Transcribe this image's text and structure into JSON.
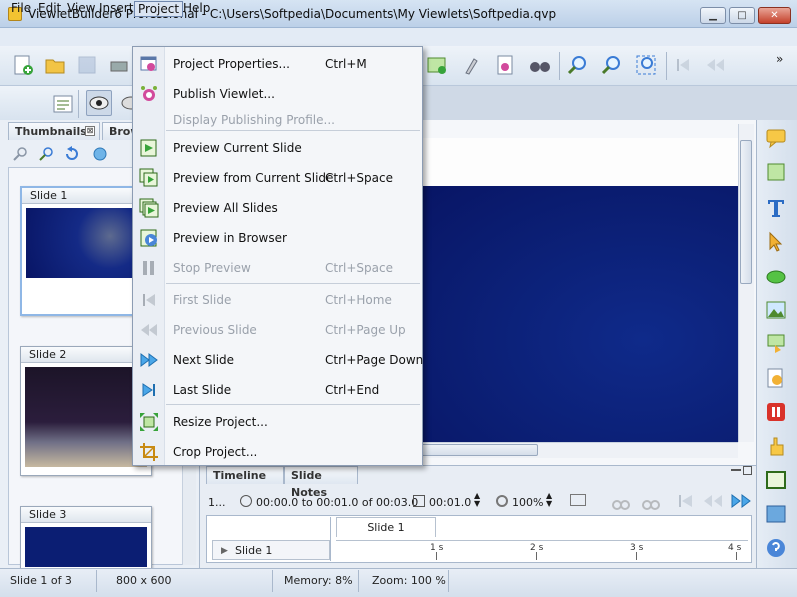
{
  "window": {
    "title": "ViewletBuilder6 Professional - C:\\Users\\Softpedia\\Documents\\My Viewlets\\Softpedia.qvp",
    "minimize": "▁",
    "maximize": "□",
    "close": "✕"
  },
  "menubar": {
    "file": "File",
    "edit": "Edit",
    "view": "View",
    "insert": "Insert",
    "project": "Project",
    "help": "Help"
  },
  "toolbar_overflow": "»",
  "left_panel": {
    "tab_thumbnails": "Thumbnails",
    "tab_close": "⊠",
    "tab_browser": "Brow",
    "slides": [
      {
        "label": "Slide 1"
      },
      {
        "label": "Slide 2"
      },
      {
        "label": "Slide 3"
      }
    ]
  },
  "project_menu": {
    "items": [
      {
        "label": "Project Properties...",
        "shortcut": "Ctrl+M",
        "enabled": true,
        "icon": "properties-icon"
      },
      {
        "label": "Publish Viewlet...",
        "shortcut": "",
        "enabled": true,
        "icon": "publish-icon"
      },
      {
        "label": "Display Publishing Profile...",
        "shortcut": "",
        "enabled": false,
        "icon": ""
      },
      {
        "label": "Preview Current Slide",
        "shortcut": "",
        "enabled": true,
        "icon": "preview-slide-icon"
      },
      {
        "label": "Preview from Current Slide",
        "shortcut": "Ctrl+Space",
        "enabled": true,
        "icon": "preview-from-icon"
      },
      {
        "label": "Preview All Slides",
        "shortcut": "",
        "enabled": true,
        "icon": "preview-all-icon"
      },
      {
        "label": "Preview in Browser",
        "shortcut": "",
        "enabled": true,
        "icon": "preview-browser-icon"
      },
      {
        "label": "Stop Preview",
        "shortcut": "Ctrl+Space",
        "enabled": false,
        "icon": "pause-icon"
      },
      {
        "label": "First Slide",
        "shortcut": "Ctrl+Home",
        "enabled": false,
        "icon": "first-slide-icon"
      },
      {
        "label": "Previous Slide",
        "shortcut": "Ctrl+Page Up",
        "enabled": false,
        "icon": "previous-slide-icon"
      },
      {
        "label": "Next Slide",
        "shortcut": "Ctrl+Page Down",
        "enabled": true,
        "icon": "next-slide-icon"
      },
      {
        "label": "Last Slide",
        "shortcut": "Ctrl+End",
        "enabled": true,
        "icon": "last-slide-icon"
      },
      {
        "label": "Resize Project...",
        "shortcut": "",
        "enabled": true,
        "icon": "resize-icon"
      },
      {
        "label": "Crop Project...",
        "shortcut": "",
        "enabled": true,
        "icon": "crop-icon"
      }
    ]
  },
  "timeline": {
    "tab_timeline": "Timeline",
    "tab_notes": "Slide Notes",
    "index": "1...",
    "time_range": "00:00.0 to 00:01.0 of 00:03.0",
    "duration": "00:01.0",
    "zoom": "100%",
    "slide_label": "Slide 1",
    "row_label": "Slide 1",
    "ticks": [
      "1 s",
      "2 s",
      "3 s",
      "4 s"
    ]
  },
  "statusbar": {
    "slide": "Slide 1 of 3",
    "size": "800 x 600",
    "memory": "Memory: 8%",
    "zoom": "Zoom: 100 %"
  },
  "colors": {
    "accent": "#2b5fb5",
    "stage_blue": "#0b1e73",
    "menu_bg": "#f4f6f9"
  }
}
